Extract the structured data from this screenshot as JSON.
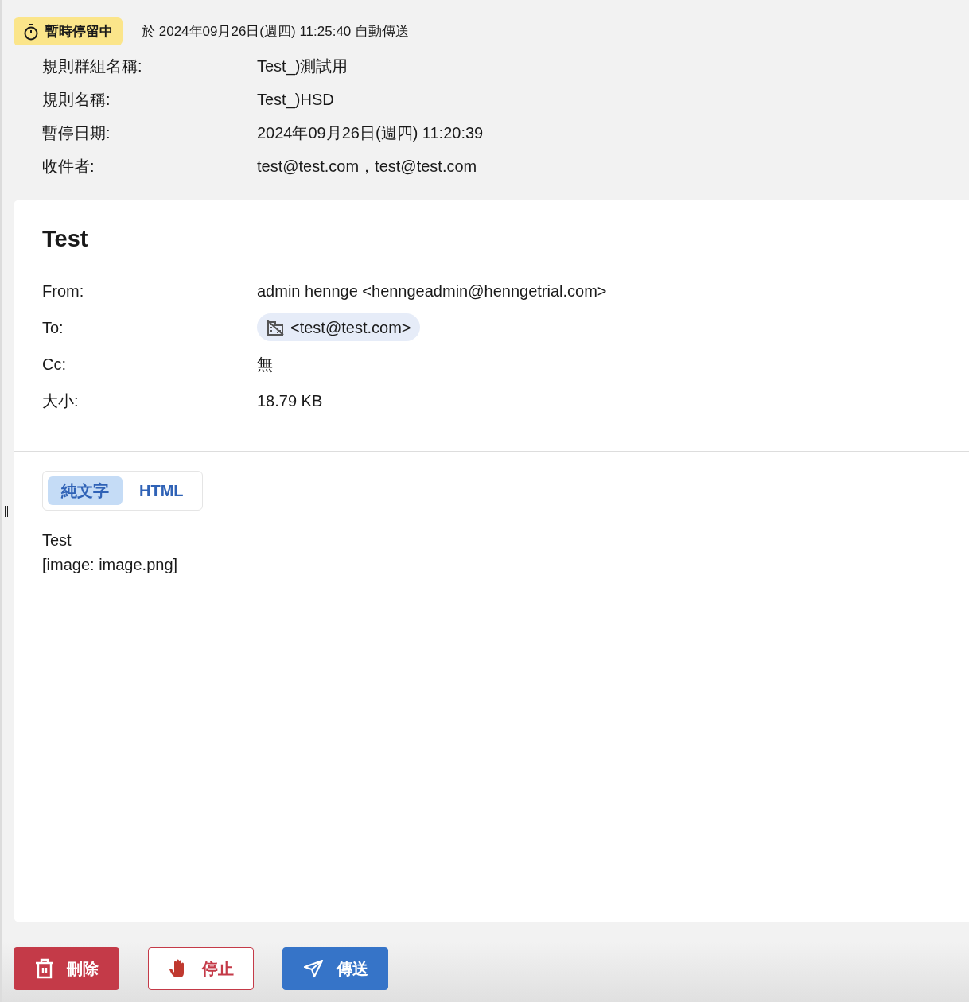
{
  "status_badge": {
    "label": "暫時停留中"
  },
  "auto_send_note": "於 2024年09月26日(週四) 11:25:40 自動傳送",
  "rule_info": [
    {
      "label": "規則群組名稱:",
      "value": "Test_)測試用"
    },
    {
      "label": "規則名稱:",
      "value": "Test_)HSD"
    },
    {
      "label": "暫停日期:",
      "value": "2024年09月26日(週四) 11:20:39"
    },
    {
      "label": "收件者:",
      "value": "test@test.com，test@test.com"
    }
  ],
  "message": {
    "subject": "Test",
    "headers": [
      {
        "label": "From:",
        "kind": "text",
        "value": "admin hennge <henngeadmin@henngetrial.com>"
      },
      {
        "label": "To:",
        "kind": "recipients",
        "recipients": [
          "<test@test.com>"
        ]
      },
      {
        "label": "Cc:",
        "kind": "text",
        "value": "無"
      },
      {
        "label": "大小:",
        "kind": "text",
        "value": "18.79 KB"
      }
    ],
    "view_tabs": [
      {
        "label": "純文字",
        "selected": true
      },
      {
        "label": "HTML",
        "selected": false
      }
    ],
    "body_lines": [
      "Test",
      "[image: image.png]"
    ]
  },
  "actions": [
    {
      "label": "刪除",
      "kind": "delete"
    },
    {
      "label": "停止",
      "kind": "stop"
    },
    {
      "label": "傳送",
      "kind": "send"
    }
  ]
}
